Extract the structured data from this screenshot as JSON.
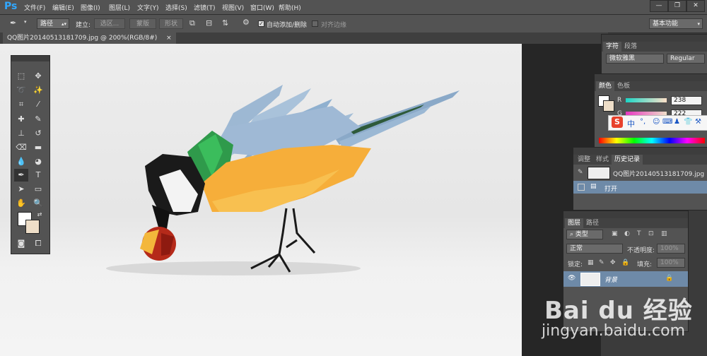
{
  "app": {
    "logo": "Ps",
    "accent": "#31a8ff"
  },
  "menu": [
    "文件(F)",
    "编辑(E)",
    "图像(I)",
    "图层(L)",
    "文字(Y)",
    "选择(S)",
    "滤镜(T)",
    "视图(V)",
    "窗口(W)",
    "帮助(H)"
  ],
  "window_controls": {
    "minimize": "—",
    "restore": "❐",
    "close": "✕"
  },
  "options": {
    "mode": "路径",
    "build_label": "建立:",
    "selection_btn": "选区...",
    "mask_btn": "蒙版",
    "shape_btn": "形状",
    "auto_add_label": "自动添加/删除",
    "align_edges_label": "对齐边缘",
    "workspace": "基本功能"
  },
  "document": {
    "tab_title": "QQ图片20140513181709.jpg @ 200%(RGB/8#)",
    "close": "×"
  },
  "character_panel": {
    "tabs": [
      "字符",
      "段落"
    ],
    "font": "微软雅黑",
    "style": "Regular"
  },
  "color_panel": {
    "tabs": [
      "颜色",
      "色板"
    ],
    "r_label": "R",
    "r_value": "238",
    "g_label": "G",
    "g_value": "222"
  },
  "ime_bar": {
    "logo": "S",
    "lang": "中"
  },
  "history_panel": {
    "tabs": [
      "调整",
      "样式",
      "历史记录"
    ],
    "snapshot": "QQ图片20140513181709.jpg",
    "open_state": "打开"
  },
  "layers_panel": {
    "tabs": [
      "图层",
      "路径"
    ],
    "filter_kind": "类型",
    "blend_mode": "正常",
    "opacity_label": "不透明度:",
    "opacity_value": "100%",
    "lock_label": "锁定:",
    "fill_label": "填充:",
    "fill_value": "100%",
    "layer_name": "背景"
  },
  "watermark": {
    "brand": "Bai du 经验",
    "url": "jingyan.baidu.com"
  }
}
